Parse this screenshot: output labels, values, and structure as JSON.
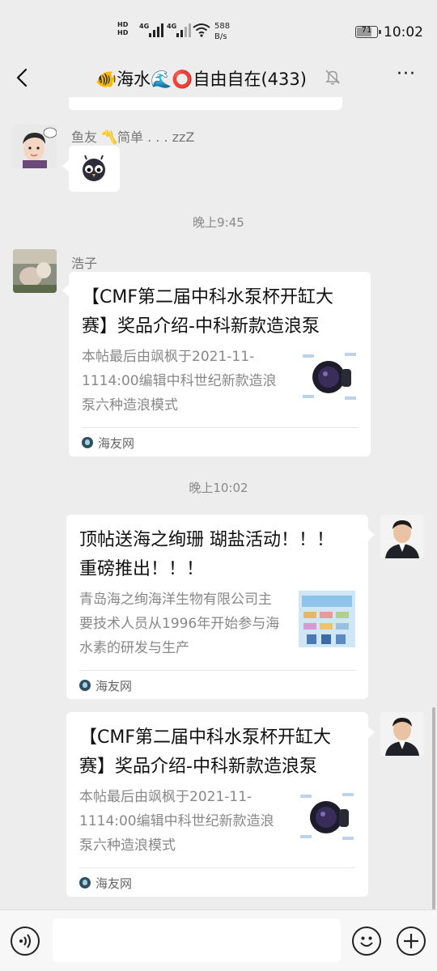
{
  "status_bar": {
    "hd1": "HD",
    "hd2": "HD",
    "net1": "4G",
    "net2": "4G",
    "speed_value": "588",
    "speed_unit": "B/s",
    "battery": "71",
    "time": "10:02"
  },
  "header": {
    "title": "🐠海水🌊⭕自由自在(433)",
    "back_icon": "chevron-left-icon",
    "mute_icon": "bell-off-icon",
    "more_label": "···"
  },
  "chat": {
    "messages": [
      {
        "sender": "鱼友 〽️简单 . . . zzZ",
        "type": "sticker",
        "sticker_icon": "owl-sticker-icon"
      },
      {
        "timestamp": "晚上9:45"
      },
      {
        "sender": "浩子",
        "type": "link-card",
        "title": "【CMF第二届中科水泵杯开缸大赛】奖品介绍-中科新款造浪泵",
        "description": "本帖最后由飒枫于2021-11-1114:00编辑中科世纪新款造浪泵六种造浪模式",
        "source": "海友网"
      },
      {
        "timestamp": "晚上10:02"
      },
      {
        "sender": "self",
        "type": "link-card",
        "title": "顶帖送海之绚珊 瑚盐活动！！！ 重磅推出！！！",
        "description": "青岛海之绚海洋生物有限公司主要技术人员从1996年开始参与海水素的研发与生产",
        "source": "海友网"
      },
      {
        "sender": "self",
        "type": "link-card",
        "title": "【CMF第二届中科水泵杯开缸大赛】奖品介绍-中科新款造浪泵",
        "description": "本帖最后由飒枫于2021-11-1114:00编辑中科世纪新款造浪泵六种造浪模式",
        "source": "海友网"
      }
    ]
  },
  "input_bar": {
    "voice_icon": "voice-icon",
    "placeholder": "",
    "emoji_icon": "emoji-icon",
    "plus_icon": "plus-icon"
  },
  "colors": {
    "background": "#ededed",
    "bubble": "#ffffff",
    "meta_text": "#888888"
  }
}
